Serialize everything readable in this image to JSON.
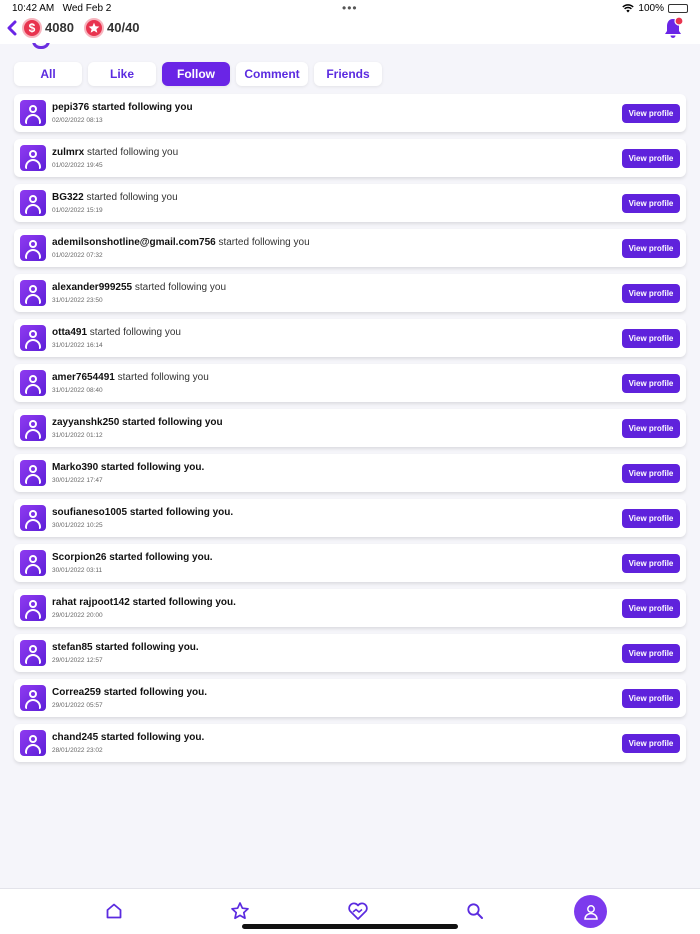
{
  "status_bar": {
    "time": "10:42 AM",
    "date": "Wed Feb 2",
    "battery": "100%",
    "icons": [
      "wifi-icon",
      "battery-icon"
    ]
  },
  "header": {
    "coins": "4080",
    "coin_symbol": "$",
    "stars": "40/40",
    "icons": [
      "back-chevron-icon",
      "coin-icon",
      "star-icon",
      "bell-icon"
    ],
    "accent": "#6a25e6",
    "badge_color": "#e8344f"
  },
  "tabs": [
    {
      "label": "All",
      "active": false
    },
    {
      "label": "Like",
      "active": false
    },
    {
      "label": "Follow",
      "active": true
    },
    {
      "label": "Comment",
      "active": false
    },
    {
      "label": "Friends",
      "active": false
    }
  ],
  "notifications": [
    {
      "user": "pepi376",
      "text": " started following you",
      "time": "02/02/2022 08:13",
      "action": "View profile"
    },
    {
      "user": "zulmrx",
      "text": " started following you",
      "time": "01/02/2022 19:45",
      "action": "View profile"
    },
    {
      "user": "BG322",
      "text": " started following you",
      "time": "01/02/2022 15:19",
      "action": "View profile"
    },
    {
      "user": "ademilsonshotline@gmail.com756",
      "text": " started following you",
      "time": "01/02/2022 07:32",
      "action": "View profile"
    },
    {
      "user": "alexander999255",
      "text": " started following you",
      "time": "31/01/2022 23:50",
      "action": "View profile"
    },
    {
      "user": "otta491",
      "text": " started following you",
      "time": "31/01/2022 16:14",
      "action": "View profile"
    },
    {
      "user": "amer7654491",
      "text": " started following you",
      "time": "31/01/2022 08:40",
      "action": "View profile"
    },
    {
      "user": "zayyanshk250",
      "text": " started following you",
      "time": "31/01/2022 01:12",
      "action": "View profile"
    },
    {
      "user": "Marko390",
      "text": " started following you.",
      "time": "30/01/2022 17:47",
      "action": "View profile"
    },
    {
      "user": "soufianeso1005",
      "text": " started following you.",
      "time": "30/01/2022 10:25",
      "action": "View profile"
    },
    {
      "user": "Scorpion26",
      "text": " started following you.",
      "time": "30/01/2022 03:11",
      "action": "View profile"
    },
    {
      "user": "rahat rajpoot142",
      "text": " started following you.",
      "time": "29/01/2022 20:00",
      "action": "View profile"
    },
    {
      "user": "stefan85",
      "text": " started following you.",
      "time": "29/01/2022 12:57",
      "action": "View profile"
    },
    {
      "user": "Correa259",
      "text": " started following you.",
      "time": "29/01/2022 05:57",
      "action": "View profile"
    },
    {
      "user": "chand245",
      "text": " started following you.",
      "time": "28/01/2022 23:02",
      "action": "View profile"
    }
  ],
  "bottom_nav": [
    "home-icon",
    "star-icon",
    "handshake-heart-icon",
    "search-icon",
    "profile-icon"
  ]
}
